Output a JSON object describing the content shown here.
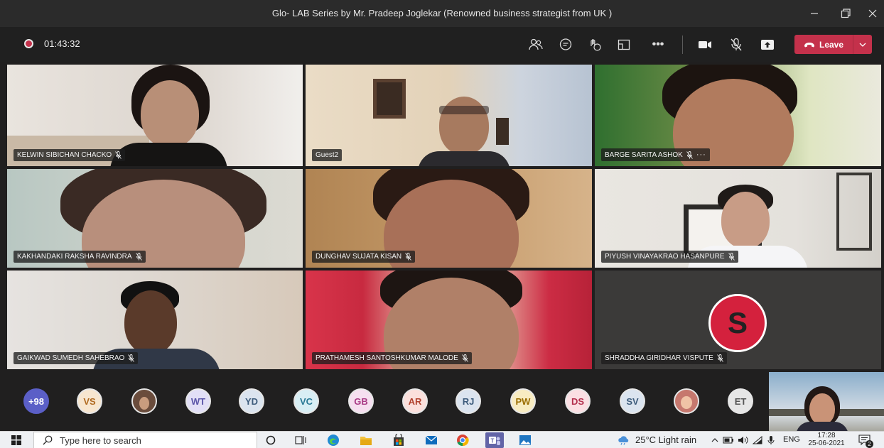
{
  "window": {
    "title": "Glo- LAB Series by Mr. Pradeep Joglekar (Renowned business strategist from UK )"
  },
  "toolbar": {
    "timer": "01:43:32",
    "leave_label": "Leave",
    "accent": "#c4314b"
  },
  "tiles": [
    {
      "name": "KELWIN SIBICHAN CHACKO",
      "muted": true
    },
    {
      "name": "Guest2",
      "muted": false
    },
    {
      "name": "BARGE SARITA ASHOK",
      "muted": true,
      "more": "···"
    },
    {
      "name": "KAKHANDAKI RAKSHA RAVINDRA",
      "muted": true
    },
    {
      "name": "DUNGHAV SUJATA KISAN",
      "muted": true
    },
    {
      "name": "PIYUSH VINAYAKRAO HASANPURE",
      "muted": true
    },
    {
      "name": "GAIKWAD SUMEDH SAHEBRAO",
      "muted": true
    },
    {
      "name": "PRATHAMESH SANTOSHKUMAR MALODE",
      "muted": true
    },
    {
      "name": "SHRADDHA GIRIDHAR VISPUTE",
      "muted": true,
      "initial": "S"
    }
  ],
  "participants": {
    "overflow": "+98",
    "avatars": [
      {
        "initials": "VS",
        "bg": "#f7e6cf",
        "fg": "#b06a20"
      },
      {
        "initials": "",
        "photo": true
      },
      {
        "initials": "WT",
        "bg": "#e2dff6",
        "fg": "#5b55a8"
      },
      {
        "initials": "YD",
        "bg": "#dbe4ef",
        "fg": "#3d5c7c"
      },
      {
        "initials": "VC",
        "bg": "#d8eef4",
        "fg": "#2b7a96"
      },
      {
        "initials": "GB",
        "bg": "#f6dff0",
        "fg": "#a93b86"
      },
      {
        "initials": "AR",
        "bg": "#fbe0dc",
        "fg": "#b2432f"
      },
      {
        "initials": "RJ",
        "bg": "#dbe4ef",
        "fg": "#3d5c7c"
      },
      {
        "initials": "PW",
        "bg": "#f8ecc2",
        "fg": "#9a6d00"
      },
      {
        "initials": "DS",
        "bg": "#fbdfe3",
        "fg": "#b32f4d"
      },
      {
        "initials": "SV",
        "bg": "#dbe4ef",
        "fg": "#3d5c7c"
      },
      {
        "initials": "",
        "photo": true
      },
      {
        "initials": "ET",
        "bg": "#e6e6e6",
        "fg": "#555"
      }
    ]
  },
  "taskbar": {
    "search_placeholder": "Type here to search",
    "weather": "25°C  Light rain",
    "language": "ENG",
    "time": "17:28",
    "date": "25-06-2021",
    "notification_count": "2"
  }
}
